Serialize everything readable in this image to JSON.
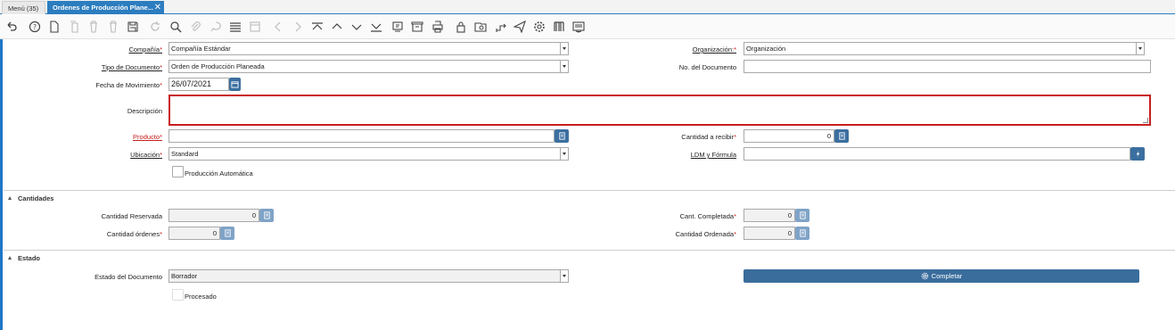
{
  "tabs": {
    "menu": "Menú (35)",
    "active": "Ordenes de Producción Plane...",
    "close": "✕"
  },
  "toolbar_icons": [
    "undo-icon",
    "help-icon",
    "new-record-icon",
    "copy-icon",
    "delete-icon",
    "delete-selection-icon",
    "save-icon",
    "refresh-icon",
    "find-icon",
    "attachment-icon",
    "chat-icon",
    "grid-toggle-icon",
    "history-icon",
    "previous-icon",
    "next-icon",
    "first-record-icon",
    "previous-record-icon",
    "next-record-icon",
    "last-record-icon",
    "report-icon",
    "archive-icon",
    "print-icon",
    "lock-icon",
    "zoom-across-icon",
    "workflow-icon",
    "process-icon",
    "settings-icon",
    "product-info-icon",
    "more-icon"
  ],
  "form": {
    "compania": {
      "label": "Compañía",
      "value": "Compañía Estándar"
    },
    "organizacion": {
      "label": "Organización:",
      "value": "Organización"
    },
    "tipo_documento": {
      "label": "Tipo de Documento",
      "value": "Orden de Producción Planeada"
    },
    "no_documento": {
      "label": "No. del Documento",
      "value": ""
    },
    "fecha_movimiento": {
      "label": "Fecha de Movimiento",
      "value": "26/07/2021"
    },
    "descripcion": {
      "label": "Descripción",
      "value": ""
    },
    "producto": {
      "label": "Producto",
      "value": ""
    },
    "cantidad_recibir": {
      "label": "Cantidad a recibir",
      "value": "0"
    },
    "ubicacion": {
      "label": "Ubicación",
      "value": "Standard"
    },
    "ldm_formula": {
      "label": "LDM y Fórmula",
      "value": ""
    },
    "produccion_automatica": {
      "label": "Producción Automática"
    }
  },
  "cantidades": {
    "title": "Cantidades",
    "reservada": {
      "label": "Cantidad Reservada",
      "value": "0"
    },
    "completada": {
      "label": "Cant. Completada",
      "value": "0"
    },
    "ordenes": {
      "label": "Cantidad órdenes",
      "value": "0"
    },
    "ordenada": {
      "label": "Cantidad Ordenada",
      "value": "0"
    }
  },
  "estado": {
    "title": "Estado",
    "estado_documento": {
      "label": "Estado del Documento",
      "value": "Borrador"
    },
    "completar": "Completar",
    "procesado": {
      "label": "Procesado"
    }
  },
  "colors": {
    "accent": "#2c7dbf",
    "required_border": "#c81e1e",
    "button": "#3a6d9c"
  }
}
